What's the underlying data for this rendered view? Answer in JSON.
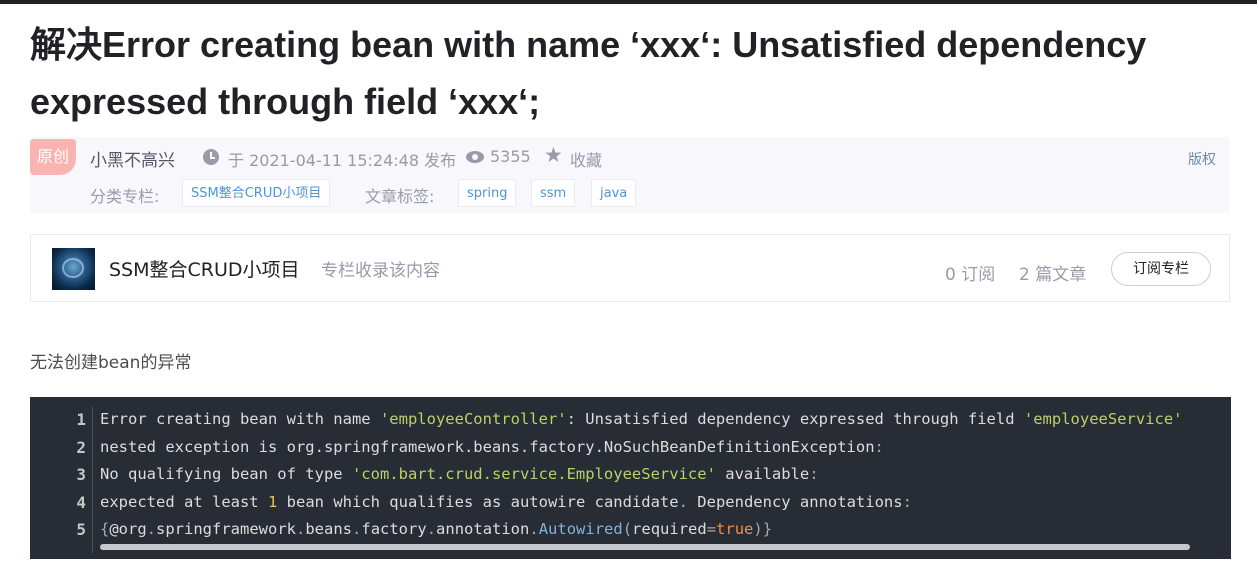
{
  "article": {
    "title": "解决Error creating bean with name ‘xxx‘: Unsatisfied dependency expressed through field ‘xxx‘;"
  },
  "meta": {
    "badge": "原创",
    "author": "小黑不高兴",
    "date": "于 2021-04-11 15:24:48 发布",
    "views": "5355",
    "collect": "收藏",
    "copyright": "版权",
    "category_label": "分类专栏:",
    "category": "SSM整合CRUD小项目",
    "tags_label": "文章标签:",
    "tags": [
      "spring",
      "ssm",
      "java"
    ]
  },
  "column": {
    "name": "SSM整合CRUD小项目",
    "desc": "专栏收录该内容",
    "subscribers": "0 订阅",
    "articles": "2 篇文章",
    "subscribe_button": "订阅专栏"
  },
  "content": {
    "paragraph": "无法创建bean的异常"
  },
  "code": {
    "line_numbers": [
      "1",
      "2",
      "3",
      "4",
      "5"
    ],
    "l1": {
      "t1": "Error creating bean with name ",
      "s1": "'employeeController'",
      "t2": ": Unsatisfied dependency expressed through field ",
      "s2": "'employeeService'"
    },
    "l2": {
      "t1": "nested exception is org.springframework.beans.factory.NoSuchBeanDefinitionException",
      "p1": ":"
    },
    "l3": {
      "t1": "No qualifying bean of type ",
      "s1": "'com.bart.crud.service.EmployeeService'",
      "t2": " available",
      "p1": ":"
    },
    "l4": {
      "t1": "expected at least ",
      "n1": "1",
      "t2": " bean which qualifies as autowire candidate",
      "p1": ".",
      "t3": " Dependency annotations",
      "p2": ":"
    },
    "l5": {
      "p1": "{",
      "t1": "@org",
      "p2": ".",
      "t2": "springframework",
      "p3": ".",
      "t3": "beans",
      "p4": ".",
      "t4": "factory",
      "p5": ".",
      "t5": "annotation",
      "p6": ".",
      "f1": "Autowired",
      "p7": "(",
      "t6": "required",
      "p8": "=",
      "k1": "true",
      "p9": ")}"
    }
  }
}
